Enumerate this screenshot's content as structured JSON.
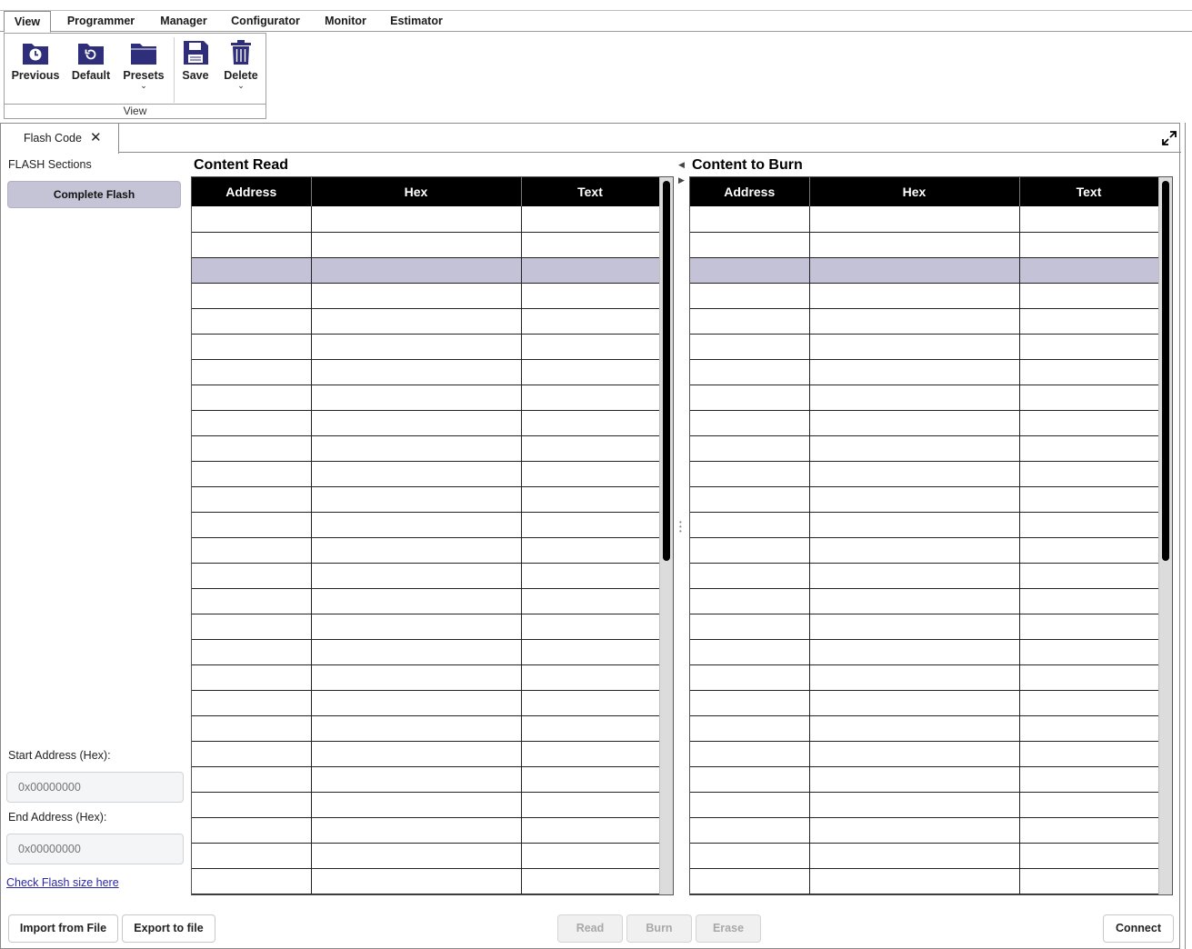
{
  "menu": {
    "tabs": [
      {
        "label": "View",
        "active": true
      },
      {
        "label": "Programmer"
      },
      {
        "label": "Manager"
      },
      {
        "label": "Configurator"
      },
      {
        "label": "Monitor"
      },
      {
        "label": "Estimator"
      }
    ]
  },
  "ribbon": {
    "group_label": "View",
    "buttons": {
      "previous": "Previous",
      "default": "Default",
      "presets": "Presets",
      "save": "Save",
      "delete": "Delete"
    },
    "icon_color": "#2e2e7a"
  },
  "doc_tab": {
    "label": "Flash Code",
    "close_icon": "close-icon"
  },
  "left": {
    "sections_title": "FLASH Sections",
    "sections": [
      "Complete Flash"
    ],
    "start_label": "Start Address (Hex):",
    "start_placeholder": "0x00000000",
    "end_label": "End Address (Hex):",
    "end_placeholder": "0x00000000",
    "flash_link": "Check Flash size here"
  },
  "content_read": {
    "title": "Content Read",
    "columns": [
      "Address",
      "Hex",
      "Text"
    ]
  },
  "content_burn": {
    "title": "Content to Burn",
    "columns": [
      "Address",
      "Hex",
      "Text"
    ]
  },
  "grid": {
    "visible_rows": 27,
    "selected_row": 3,
    "selection_color": "#c3c2d6"
  },
  "actions": {
    "import": "Import from File",
    "export": "Export to file",
    "read": "Read",
    "burn": "Burn",
    "erase": "Erase",
    "connect": "Connect"
  }
}
